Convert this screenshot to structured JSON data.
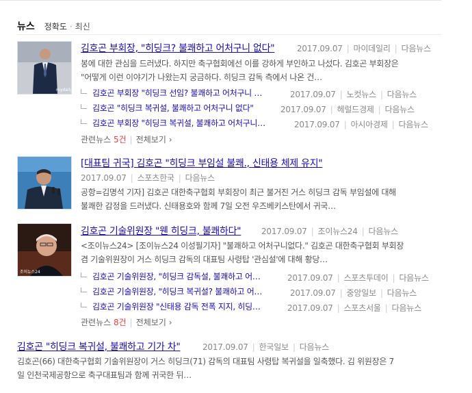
{
  "header": {
    "title": "뉴스",
    "sort_accuracy": "정확도",
    "sort_dot": "·",
    "sort_latest": "최신"
  },
  "items": [
    {
      "title": "김호곤 부회장, \"히딩크? 불쾌하고 어처구니 없다\"",
      "date": "2017.09.07",
      "source": "마이데일리",
      "daum": "다음뉴스",
      "desc1": "봉에 대한 관심을 드러냈다. 하지만 축구협회에선 이를 강하게 부인하고 나섰다. 김호곤 부회장은",
      "desc2": "\"어떻게 이런 이야기가 나왔는지 궁금하다. 히딩크 감독 측에서 나온 건…",
      "related": [
        {
          "title": "김호곤 부회장 \"히딩크 선임? 불쾌하고 어처구니 …",
          "date": "2017.09.07",
          "source": "노컷뉴스",
          "daum": "다음뉴스"
        },
        {
          "title": "김호곤 \"히딩크 복귀설, 불쾌하고 어처구니 없다\"",
          "date": "2017.09.07",
          "source": "헤럴드경제",
          "daum": "다음뉴스"
        },
        {
          "title": "김호곤 부회장 \"히딩크 복귀설, 불쾌하고 어처구니…",
          "date": "2017.09.07",
          "source": "아시아경제",
          "daum": "다음뉴스"
        }
      ],
      "more_prefix": "관련뉴스 ",
      "more_count": "5건",
      "more_all": "전체보기",
      "more_arrow": "›"
    },
    {
      "title": "[대표팀 귀국] 김호곤 \"히딩크 부임설 불쾌., 신태용 체제 유지\"",
      "date": "2017.09.07",
      "source": "스포츠한국",
      "daum": "다음뉴스",
      "desc1": "공항=김명석 기자] 김호곤 대한축구협회 부회장이 최근 불거진 거스 히딩크 감독 부임설에 대해",
      "desc2": "불쾌한 감정을 드러냈다. 신태용호와 함께 7일 오전 우즈베키스탄에서 귀국…"
    },
    {
      "title": "김호곤 기술위원장 \"웬 히딩크, 불쾌하다\"",
      "date": "2017.09.07",
      "source": "조이뉴스24",
      "daum": "다음뉴스",
      "desc1": "<조이뉴스24> [조이뉴스24 이성필기자] \"불쾌하고 어처구니없다.\" 김호곤 대한축구협회 부회장",
      "desc2": "겸 기술위원장이 거스 히딩크 감독의 대표팀 사령탑 '관심설'에 대해 황당…",
      "related": [
        {
          "title": "김호곤 기술위원장, \"히딩크 감독설, 불쾌하고 어…",
          "date": "2017.09.07",
          "source": "스포츠투데이",
          "daum": "다음뉴스"
        },
        {
          "title": "김호곤 기술위원장, \"히딩크 복귀설? 불쾌하고 어…",
          "date": "2017.09.07",
          "source": "중앙일보",
          "daum": "다음뉴스"
        },
        {
          "title": "김호곤 기술위원장 \"신태용 감독 전폭 지지, 히딩…",
          "date": "2017.09.07",
          "source": "스포츠서울",
          "daum": "다음뉴스"
        }
      ],
      "more_prefix": "관련뉴스 ",
      "more_count": "8건",
      "more_all": "전체보기",
      "more_arrow": "›"
    },
    {
      "title": "김호곤 \"히딩크 복귀설, 불쾌하고 기가 차\"",
      "date": "2017.09.07",
      "source": "한국일보",
      "daum": "다음뉴스",
      "desc1": "김호곤(66) 대한축구협회 기술위원장이 거스 히딩크(71) 감독의 대표팀 사령탑 복귀설을 일축했다. 김 위원장은 7",
      "desc2": "일 인천국제공항으로 축구대표팀과 함께 귀국한 뒤…"
    }
  ],
  "thumb1_caption": "mydaily",
  "thumb3_caption": "조이뉴스24"
}
